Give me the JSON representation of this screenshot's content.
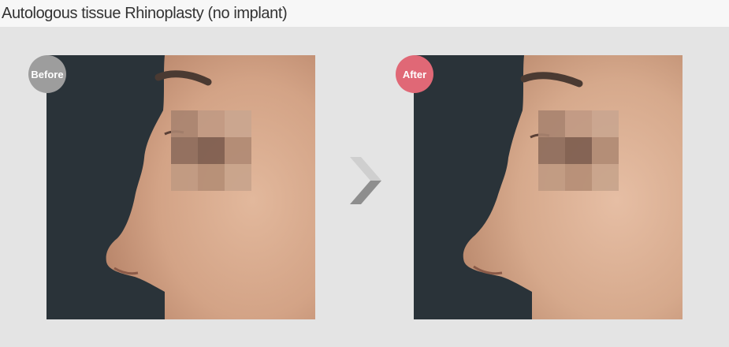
{
  "header": {
    "title": "Autologous tissue Rhinoplasty (no implant)"
  },
  "before": {
    "badge_label": "Before"
  },
  "after": {
    "badge_label": "After"
  },
  "colors": {
    "background": "#e4e4e4",
    "header_bg": "#f7f7f7",
    "before_badge": "#9d9d9d",
    "after_badge": "#e06876",
    "photo_backdrop": "#2a3339",
    "skin": "#d6a98c"
  },
  "icons": {
    "transition": "chevron-right-icon"
  }
}
